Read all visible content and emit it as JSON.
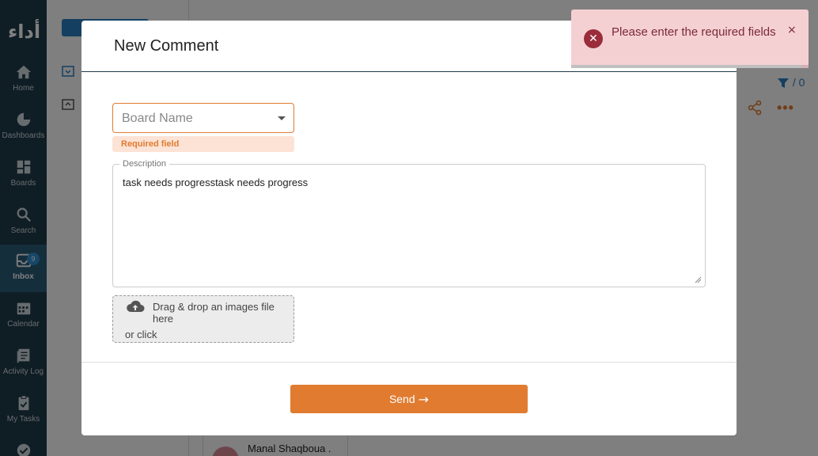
{
  "sidebar": {
    "logo": "أداء",
    "items": [
      {
        "label": "Home",
        "icon": "home-icon"
      },
      {
        "label": "Dashboards",
        "icon": "pie-chart-icon"
      },
      {
        "label": "Boards",
        "icon": "grid-icon"
      },
      {
        "label": "Search",
        "icon": "search-icon"
      },
      {
        "label": "Inbox",
        "icon": "inbox-icon",
        "badge": "9"
      },
      {
        "label": "Calendar",
        "icon": "calendar-icon"
      },
      {
        "label": "Activity Log",
        "icon": "activity-log-icon"
      },
      {
        "label": "My Tasks",
        "icon": "clipboard-icon"
      }
    ]
  },
  "background": {
    "filter_count": "/ 0",
    "card_name": "Manal Shaqboua ."
  },
  "modal": {
    "title": "New Comment",
    "board_select": {
      "placeholder": "Board Name",
      "error": "Required field"
    },
    "description": {
      "label": "Description",
      "value": "task needs progresstask needs progress"
    },
    "dropzone": {
      "line1": "Drag & drop an images file here",
      "line2": "or click"
    },
    "send_label": "Send"
  },
  "toast": {
    "message": "Please enter the required fields",
    "close": "×",
    "progress": 0.97
  },
  "colors": {
    "accent": "#e07b30",
    "sidebar": "#1f3a4a",
    "error": "#9b2c3a"
  }
}
